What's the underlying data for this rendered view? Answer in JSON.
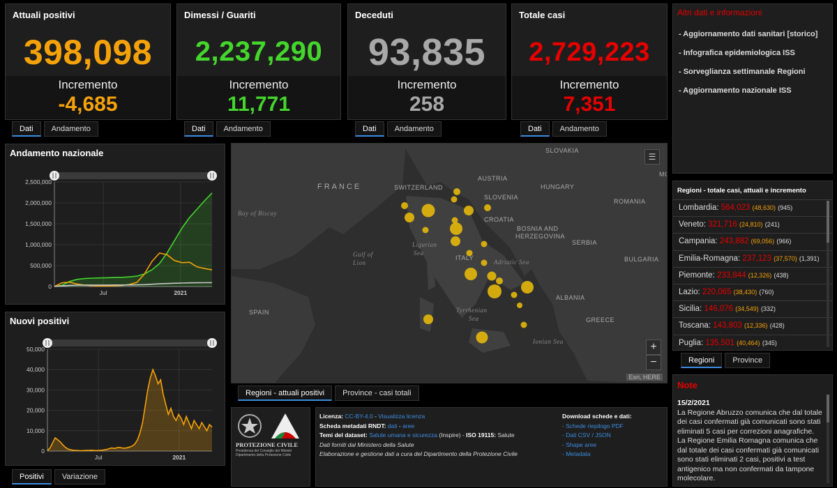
{
  "cards": [
    {
      "title": "Attuali positivi",
      "value": "398,098",
      "increment_label": "Incremento",
      "increment": "-4,685",
      "color": "#f5a20a"
    },
    {
      "title": "Dimessi / Guariti",
      "value": "2,237,290",
      "increment_label": "Incremento",
      "increment": "11,771",
      "color": "#44d62c"
    },
    {
      "title": "Deceduti",
      "value": "93,835",
      "increment_label": "Incremento",
      "increment": "258",
      "color": "#a8a8a8"
    },
    {
      "title": "Totale casi",
      "value": "2,729,223",
      "increment_label": "Incremento",
      "increment": "7,351",
      "color": "#e60000"
    }
  ],
  "card_tabs": {
    "dati": "Dati",
    "andamento": "Andamento"
  },
  "links_panel": {
    "title": "Altri dati e informazioni",
    "items": [
      "- Aggiornamento dati sanitari [storico]",
      "- Infografica epidemiologica ISS",
      "- Sorveglianza settimanale Regioni",
      "- Aggiornamento nazionale ISS"
    ]
  },
  "chart_andamento": {
    "title": "Andamento nazionale",
    "chart_data": {
      "type": "line",
      "x_ticks": [
        "Jul",
        "2021"
      ],
      "y_ticks": [
        "0",
        "500,000",
        "1,000,000",
        "1,500,000",
        "2,000,000",
        "2,500,000"
      ],
      "ylim": [
        0,
        2500000
      ],
      "series": [
        {
          "name": "",
          "color": "#44d62c",
          "values": [
            0,
            30000,
            120000,
            170000,
            190000,
            200000,
            205000,
            210000,
            215000,
            220000,
            230000,
            250000,
            300000,
            400000,
            550000,
            800000,
            1100000,
            1400000,
            1650000,
            1850000,
            2050000,
            2237290
          ]
        },
        {
          "name": "",
          "color": "#f5a20a",
          "values": [
            0,
            90000,
            105000,
            60000,
            35000,
            20000,
            14000,
            13000,
            16000,
            25000,
            50000,
            100000,
            300000,
            600000,
            800000,
            760000,
            620000,
            570000,
            580000,
            470000,
            430000,
            398098
          ]
        },
        {
          "name": "",
          "color": "#c8c8c8",
          "values": [
            0,
            15000,
            27000,
            33000,
            35000,
            35000,
            35500,
            35800,
            36000,
            36500,
            38000,
            40000,
            45000,
            55000,
            65000,
            72000,
            78000,
            84000,
            88000,
            90000,
            92000,
            93835
          ]
        }
      ]
    }
  },
  "chart_nuovi": {
    "title": "Nuovi positivi",
    "chart_data": {
      "type": "area",
      "x_ticks": [
        "Jul",
        "2021"
      ],
      "y_ticks": [
        "0",
        "10,000",
        "20,000",
        "30,000",
        "40,000",
        "50,000"
      ],
      "ylim": [
        0,
        50000
      ],
      "series": [
        {
          "name": "",
          "color": "#f5a20a",
          "values": [
            200,
            1500,
            4000,
            6500,
            5500,
            4500,
            3000,
            1800,
            1000,
            600,
            400,
            300,
            250,
            200,
            250,
            300,
            350,
            400,
            300,
            250,
            300,
            400,
            550,
            800,
            1200,
            1500,
            1300,
            1600,
            1800,
            1500,
            1400,
            1600,
            2000,
            2500,
            3500,
            5500,
            9000,
            14000,
            22000,
            30000,
            36000,
            40000,
            37000,
            33000,
            35000,
            28000,
            23000,
            18000,
            21000,
            17000,
            15000,
            18000,
            16000,
            13000,
            17000,
            14000,
            11000,
            15000,
            13000,
            11000,
            14000,
            12000,
            10000,
            13000,
            11771
          ]
        }
      ]
    }
  },
  "chart_tabs": {
    "positivi": "Positivi",
    "variazione": "Variazione"
  },
  "map": {
    "labels": [
      {
        "text": "SLOVAKIA",
        "kind": "country"
      },
      {
        "text": "FRANCE",
        "kind": "country_big"
      },
      {
        "text": "SWITZERLAND",
        "kind": "country"
      },
      {
        "text": "AUSTRIA",
        "kind": "country"
      },
      {
        "text": "HUNGARY",
        "kind": "country"
      },
      {
        "text": "SLOVENIA",
        "kind": "country"
      },
      {
        "text": "ROMANIA",
        "kind": "country"
      },
      {
        "text": "CROATIA",
        "kind": "country"
      },
      {
        "text": "BOSNIA AND",
        "kind": "country"
      },
      {
        "text": "HERZEGOVINA",
        "kind": "country"
      },
      {
        "text": "SERBIA",
        "kind": "country"
      },
      {
        "text": "BULGARIA",
        "kind": "country"
      },
      {
        "text": "ITALY",
        "kind": "country"
      },
      {
        "text": "ALBANIA",
        "kind": "country"
      },
      {
        "text": "GREECE",
        "kind": "country"
      },
      {
        "text": "SPAIN",
        "kind": "country"
      },
      {
        "text": "MO",
        "kind": "country"
      },
      {
        "text": "Bay of Biscay",
        "kind": "sea"
      },
      {
        "text": "Gulf of",
        "kind": "sea"
      },
      {
        "text": "Lion",
        "kind": "sea"
      },
      {
        "text": "Ligurian",
        "kind": "sea"
      },
      {
        "text": "Sea",
        "kind": "sea"
      },
      {
        "text": "Adriatic Sea",
        "kind": "sea"
      },
      {
        "text": "Tyrrhenian",
        "kind": "sea"
      },
      {
        "text": "Sea",
        "kind": "sea"
      },
      {
        "text": "Ionian Sea",
        "kind": "sea"
      }
    ],
    "zoom_in": "+",
    "zoom_out": "−",
    "attribution": "Esri, HERE",
    "legend_icon": "list-icon"
  },
  "map_tabs": {
    "regioni": "Regioni - attuali positivi",
    "province": "Province - casi totali"
  },
  "regions_panel": {
    "title": "Regioni - totale casi, attuali e incremento",
    "rows": [
      {
        "name": "Lombardia",
        "total": "564,023",
        "active": "(48,630)",
        "increment": "(945)"
      },
      {
        "name": "Veneto",
        "total": "321,716",
        "active": "(24,810)",
        "increment": "(241)"
      },
      {
        "name": "Campania",
        "total": "243,882",
        "active": "(69,056)",
        "increment": "(966)"
      },
      {
        "name": "Emilia-Romagna",
        "total": "237,123",
        "active": "(37,570)",
        "increment": "(1,391)"
      },
      {
        "name": "Piemonte",
        "total": "233,844",
        "active": "(12,326)",
        "increment": "(438)"
      },
      {
        "name": "Lazio",
        "total": "220,065",
        "active": "(38,430)",
        "increment": "(760)"
      },
      {
        "name": "Sicilia",
        "total": "146,076",
        "active": "(34,549)",
        "increment": "(332)"
      },
      {
        "name": "Toscana",
        "total": "143,803",
        "active": "(12,336)",
        "increment": "(428)"
      },
      {
        "name": "Puglia",
        "total": "135,501",
        "active": "(40,464)",
        "increment": "(345)"
      }
    ]
  },
  "regions_tabs": {
    "regioni": "Regioni",
    "province": "Province"
  },
  "footer": {
    "logo_text": "PROTEZIONE CIVILE",
    "logo_sub1": "Presidenza del Consiglio dei Ministri",
    "logo_sub2": "Dipartimento della Protezione Civile",
    "licenza_label": "Licenza:",
    "licenza_value": "CC-BY-4.0",
    "licenza_sep": " - ",
    "licenza_link": "Visualizza licenza",
    "scheda_label": "Scheda metadati RNDT:",
    "scheda_dati": "dati",
    "scheda_sep": " - ",
    "scheda_aree": "aree",
    "temi_label": "Temi del dataset:",
    "temi_value": "Salute umana e sicurezza",
    "temi_rest1": " (Inspire) - ",
    "temi_iso": "ISO 19115:",
    "temi_rest2": " Salute",
    "line4": "Dati forniti dal Ministero della Salute",
    "line5": "Elaborazione e gestione dati a cura del Dipartimento della Protezione Civile",
    "download_title": "Download schede e dati:",
    "downloads": [
      "- Schede riepilogo PDF",
      "- Dati CSV / JSON",
      "- Shape aree",
      "- Metadata"
    ]
  },
  "notes": {
    "title": "Note",
    "date": "15/2/2021",
    "body": "La Regione Abruzzo comunica che dal totale dei casi confermati già comunicati sono stati eliminati 5 casi per correzioni anagrafiche. La Regione Emilia Romagna comunica che dal totale dei casi confermati già comunicati sono stati eliminati 2 casi, positivi a test antigenico ma non confermati da tampone molecolare."
  },
  "colors": {
    "accent_blue": "#3d8de0",
    "panel_bg": "#1e1e1e",
    "note_red": "#e60000"
  }
}
